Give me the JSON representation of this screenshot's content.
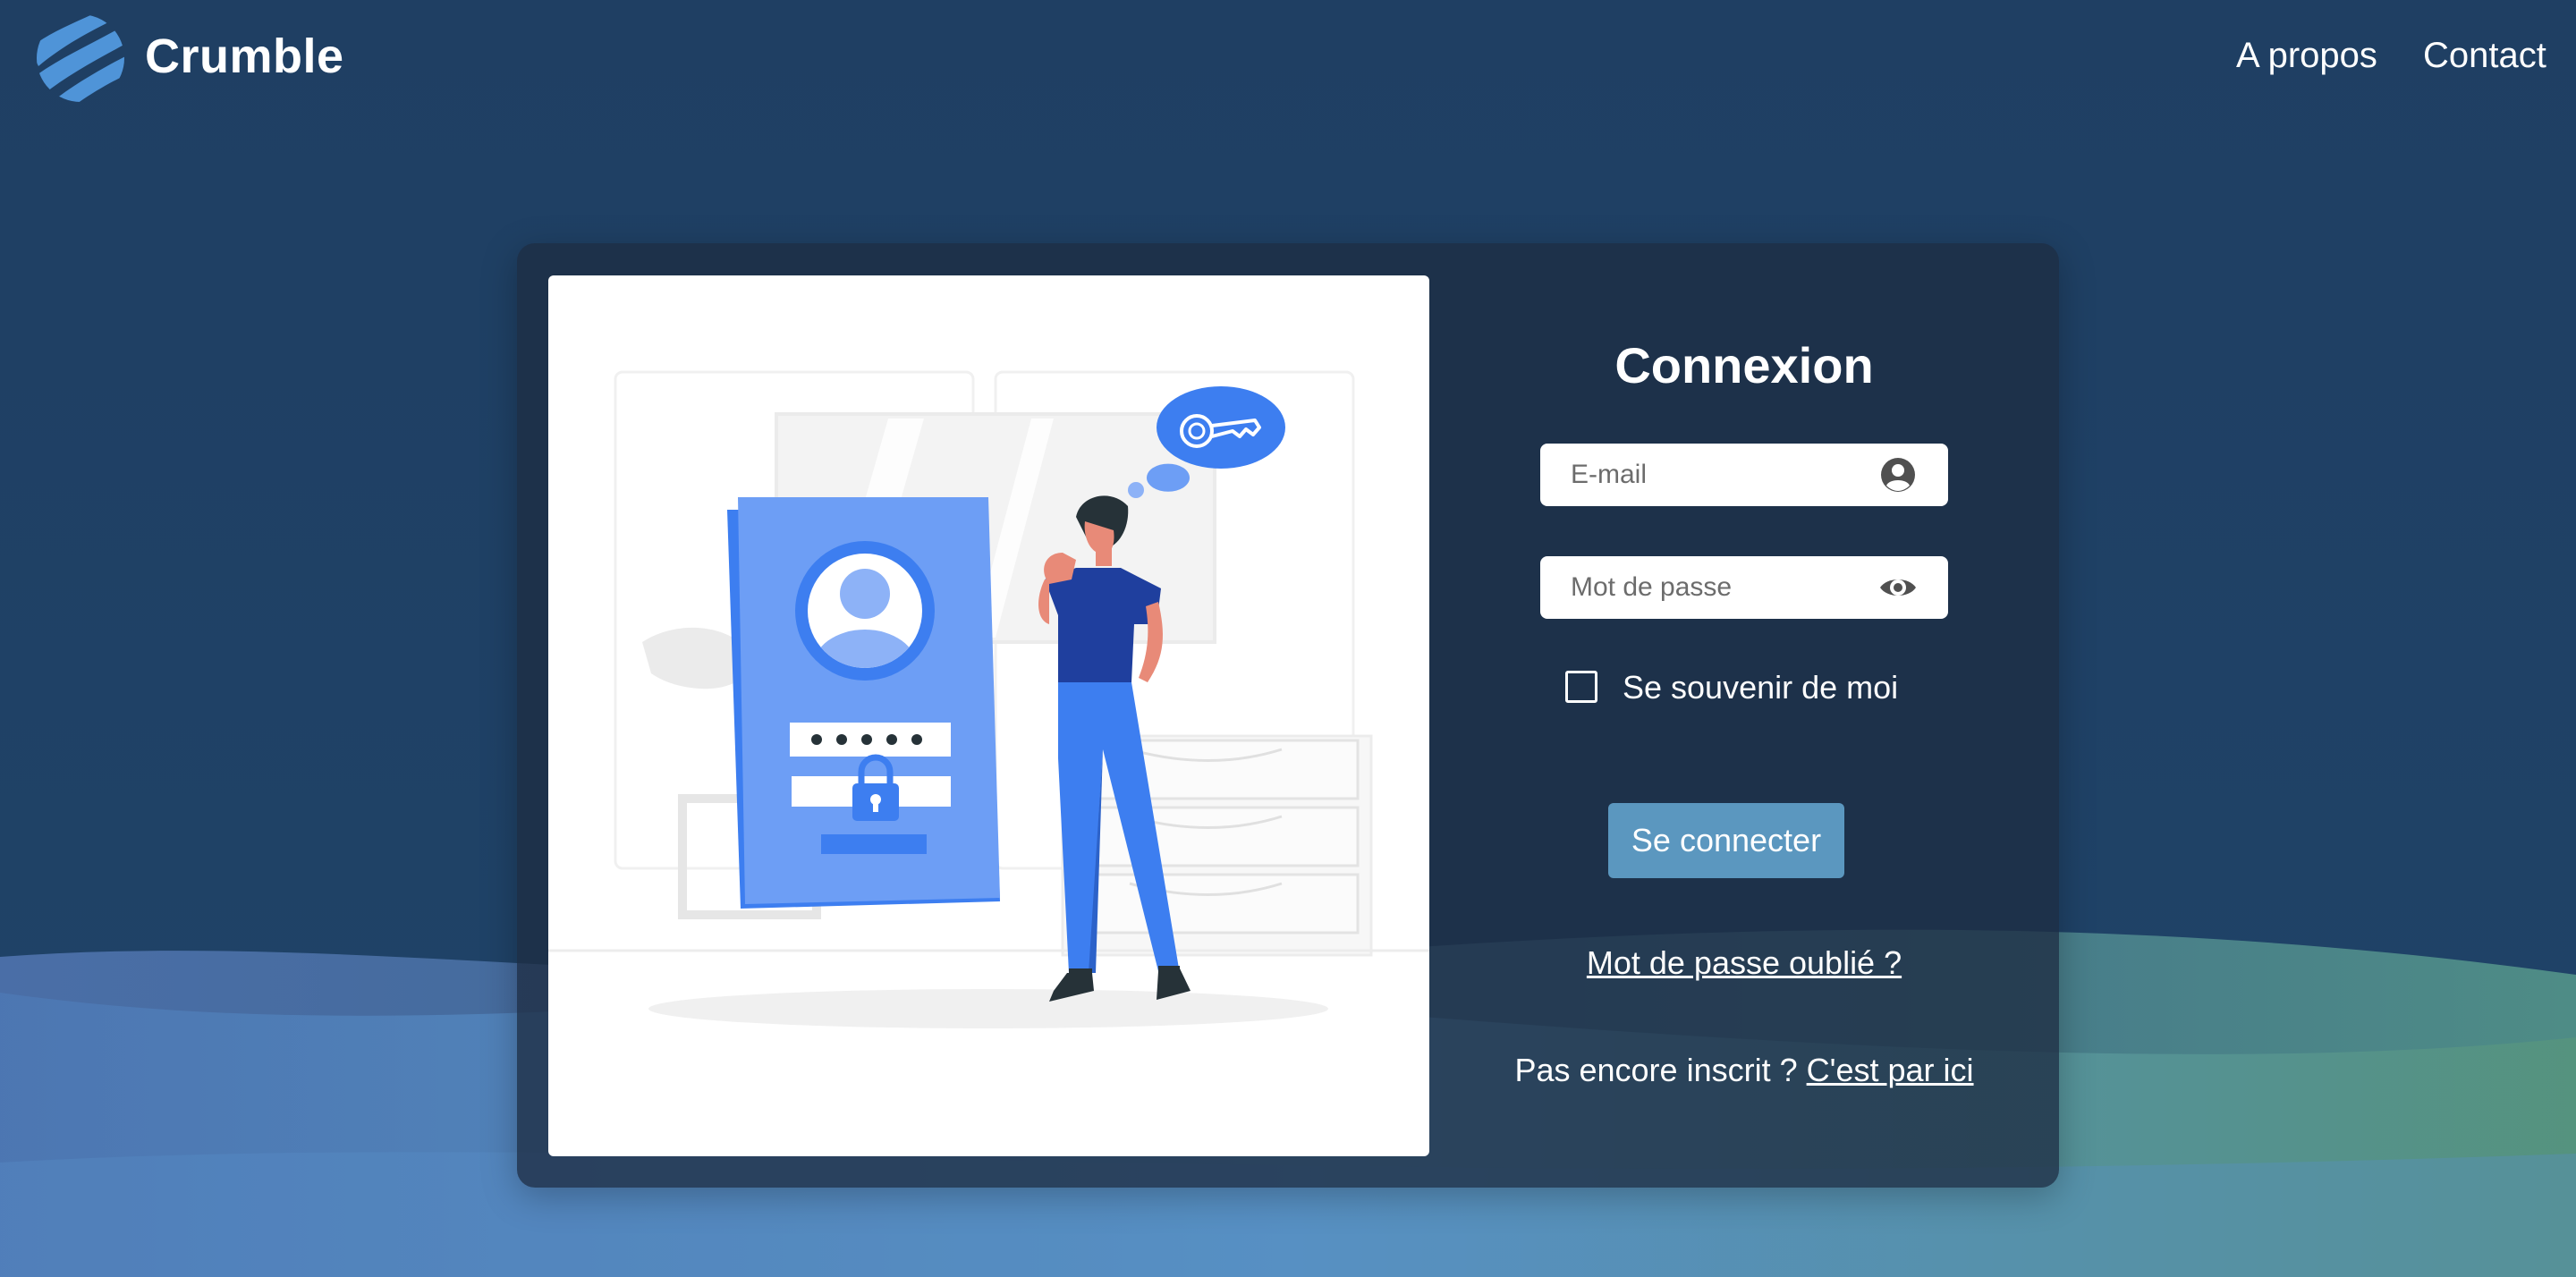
{
  "header": {
    "brand": "Crumble",
    "nav": {
      "about": "A propos",
      "contact": "Contact"
    }
  },
  "login": {
    "title": "Connexion",
    "email_placeholder": "E-mail",
    "password_placeholder": "Mot de passe",
    "remember_label": "Se souvenir de moi",
    "remember_checked": false,
    "submit_label": "Se connecter",
    "forgot_label": "Mot de passe oublié ?",
    "signup_prompt": "Pas encore inscrit ? ",
    "signup_link": "C'est par ici"
  },
  "icons": {
    "logo": "striped-sphere-logo",
    "email_field": "user-circle-icon",
    "password_field": "eye-icon"
  },
  "colors": {
    "background_top": "#1f3f63",
    "card": "#1e2d42",
    "button": "#5b97bf",
    "illustration_accent": "#3d7ef0"
  }
}
